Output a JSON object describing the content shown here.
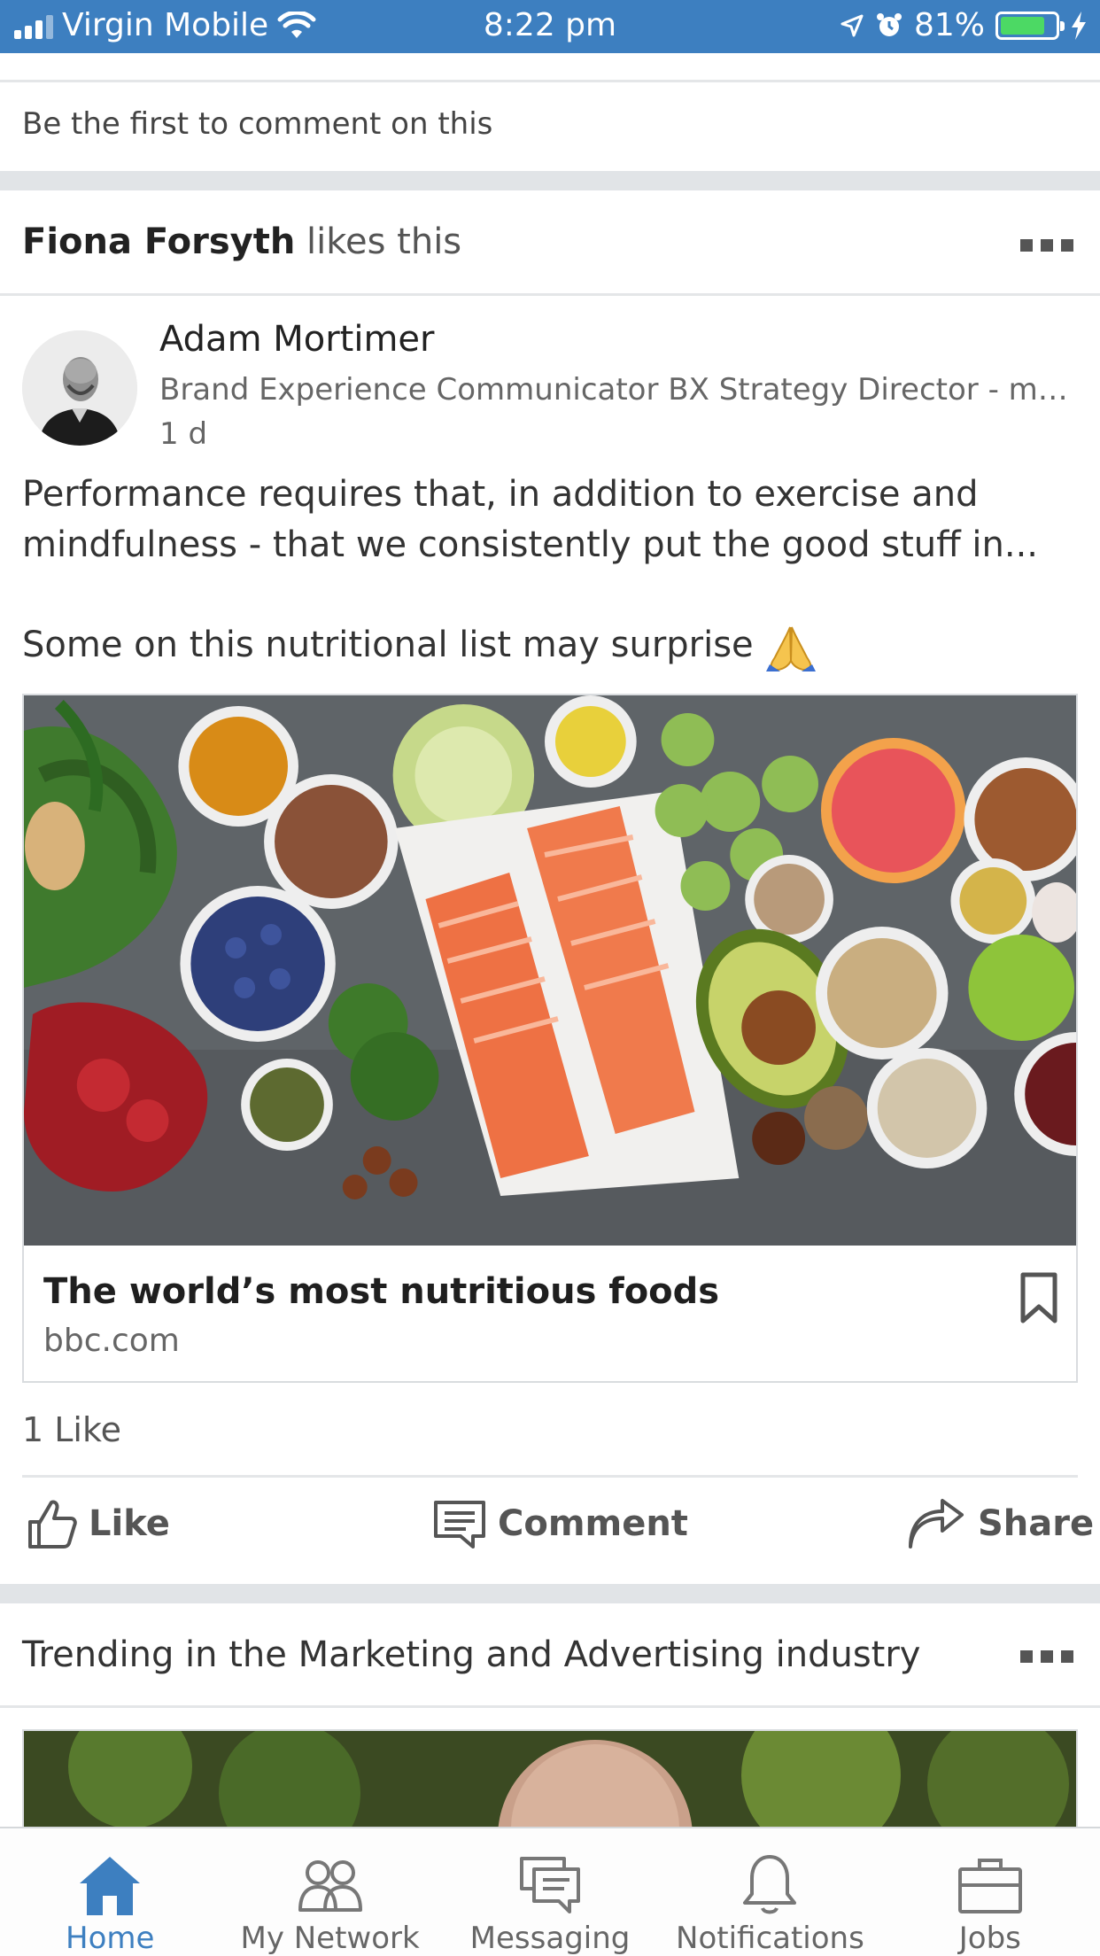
{
  "status_bar": {
    "carrier": "Virgin Mobile",
    "time": "8:22 pm",
    "battery": "81%",
    "battery_level": 0.81
  },
  "previous_post": {
    "comment_prompt": "Be the first to comment on this"
  },
  "post": {
    "liker_name": "Fiona Forsyth",
    "liker_action": "likes this",
    "author": {
      "name": "Adam Mortimer",
      "headline": "Brand Experience Communicator BX Strategy Director - motiv…",
      "time_ago": "1 d"
    },
    "text_line1": "Performance requires that, in addition to exercise and",
    "text_line2": "mindfulness - that we consistently put the good stuff in...",
    "text_line3": "Some on this nutritional list may surprise",
    "article": {
      "title": "The world’s most nutritious foods",
      "source": "bbc.com"
    },
    "like_count": "1 Like",
    "actions": {
      "like": "Like",
      "comment": "Comment",
      "share": "Share"
    }
  },
  "trending": {
    "title": "Trending in the Marketing and Advertising industry"
  },
  "bottom_nav": {
    "items": [
      {
        "label": "Home",
        "icon": "home-icon",
        "active": true
      },
      {
        "label": "My Network",
        "icon": "my-network-icon",
        "active": false
      },
      {
        "label": "Messaging",
        "icon": "messaging-icon",
        "active": false
      },
      {
        "label": "Notifications",
        "icon": "notifications-icon",
        "active": false
      },
      {
        "label": "Jobs",
        "icon": "jobs-icon",
        "active": false
      }
    ]
  },
  "colors": {
    "brand_blue": "#3d7fc0",
    "battery_green": "#4cd964"
  }
}
